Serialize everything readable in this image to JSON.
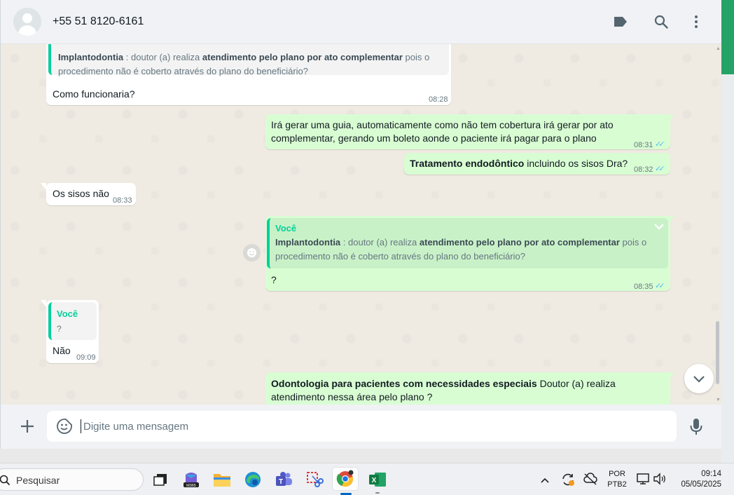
{
  "header": {
    "contact": "+55 51 8120-6161"
  },
  "messages": {
    "m1": {
      "quote_bold1": "Implantodontia",
      "quote_text1": " : doutor (a) realiza ",
      "quote_bold2": "atendimento pelo plano por ato complementar",
      "quote_text2": " pois o",
      "quote_line2": "procedimento não é coberto através do plano do beneficiário?",
      "text": "Como funcionaria?",
      "time": "08:28"
    },
    "m2": {
      "line1": "Irá gerar uma guia, automaticamente como não tem cobertura irá gerar por ato",
      "line2": "complementar, gerando um boleto aonde o paciente irá pagar para o plano",
      "time": "08:31"
    },
    "m3": {
      "bold": "Tratamento endodôntico",
      "text": " incluindo os sisos Dra?",
      "time": "08:32"
    },
    "m4": {
      "text": "Os sisos não",
      "time": "08:33"
    },
    "m5": {
      "quote_name": "Você",
      "quote_bold1": "Implantodontia",
      "quote_text1": " : doutor (a) realiza ",
      "quote_bold2": "atendimento pelo plano por ato complementar",
      "quote_text2": " pois o",
      "quote_line2": "procedimento não é coberto através do plano do beneficiário?",
      "text": "?",
      "time": "08:35"
    },
    "m6": {
      "quote_name": "Você",
      "quote_text": "?",
      "text": "Não",
      "time": "09:09"
    },
    "m7": {
      "bold": "Odontologia para pacientes com necessidades especiais",
      "text": "  Doutor (a) realiza",
      "line2": "atendimento nessa área  pelo plano ?"
    }
  },
  "composer": {
    "placeholder": "Digite uma mensagem"
  },
  "taskbar": {
    "search_label": "Pesquisar",
    "lang_top": "POR",
    "lang_bottom": "PTB2",
    "clock_time": "09:14",
    "clock_date": "05/05/2025"
  },
  "colors": {
    "outgoing": "#d9fdd3",
    "incoming": "#ffffff",
    "accent": "#06cf9c",
    "read_ticks": "#53bdeb"
  }
}
